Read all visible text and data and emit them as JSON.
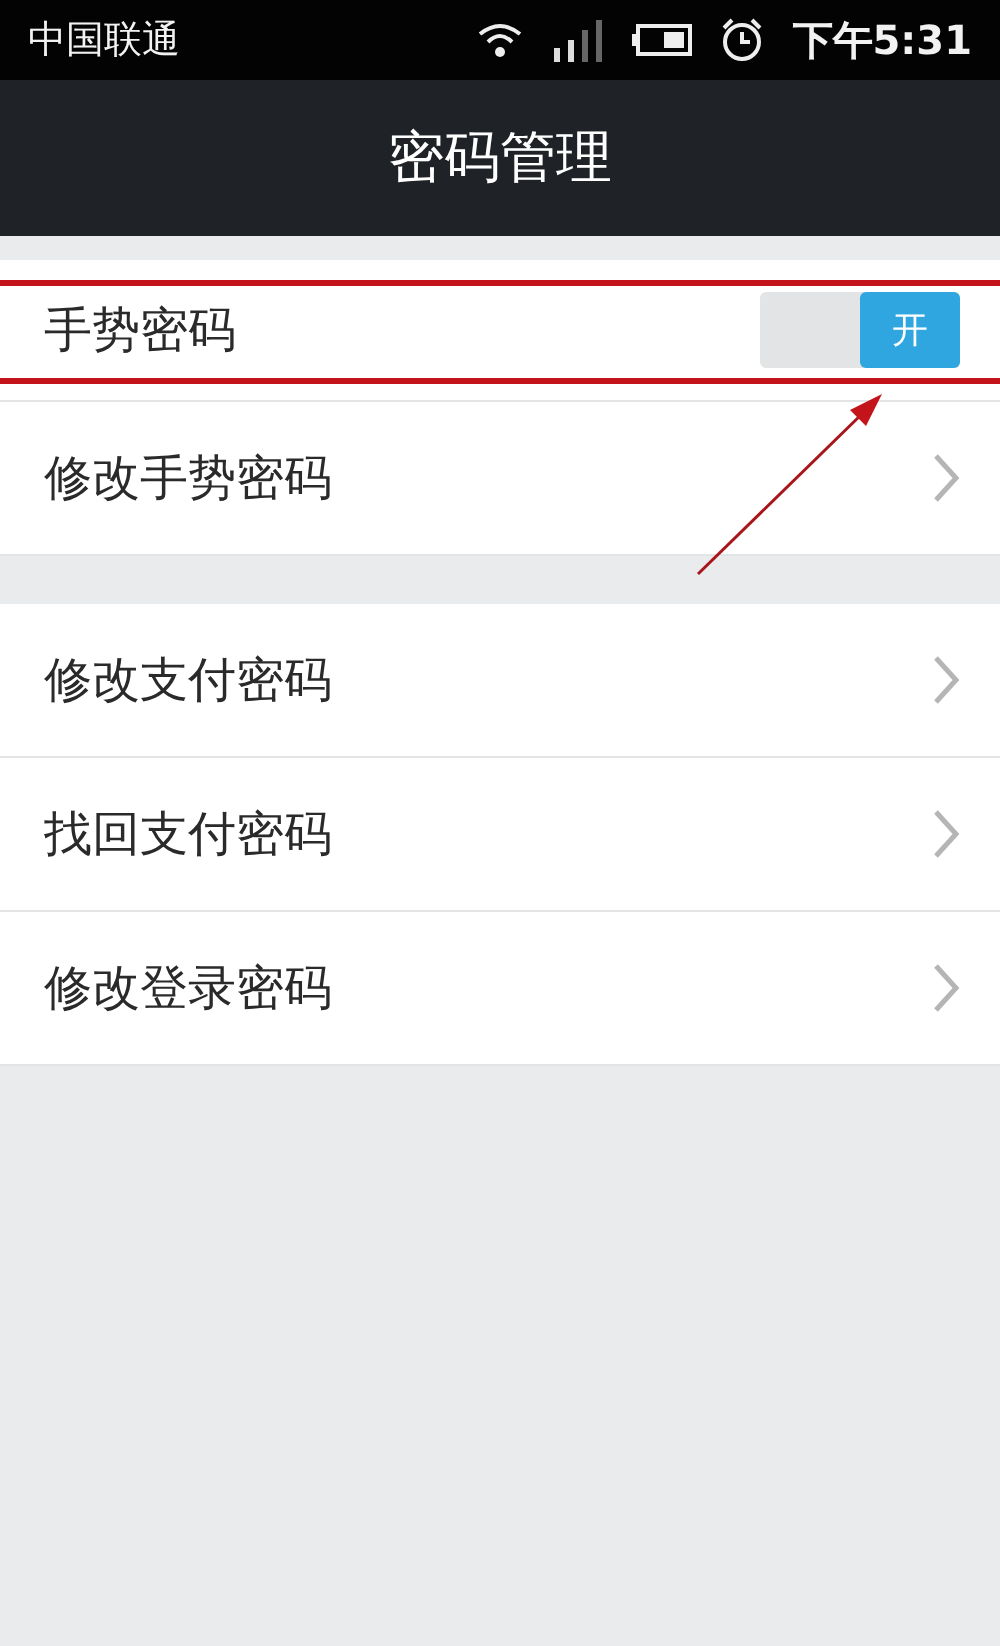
{
  "status_bar": {
    "carrier": "中国联通",
    "time": "下午5:31"
  },
  "title": "密码管理",
  "groups": [
    [
      {
        "label": "手势密码",
        "kind": "switch",
        "on": true,
        "switch_label": "开",
        "highlighted": true
      },
      {
        "label": "修改手势密码",
        "kind": "link",
        "highlighted": false
      }
    ],
    [
      {
        "label": "修改支付密码",
        "kind": "link",
        "highlighted": false
      },
      {
        "label": "找回支付密码",
        "kind": "link",
        "highlighted": false
      },
      {
        "label": "修改登录密码",
        "kind": "link",
        "highlighted": false
      }
    ]
  ]
}
